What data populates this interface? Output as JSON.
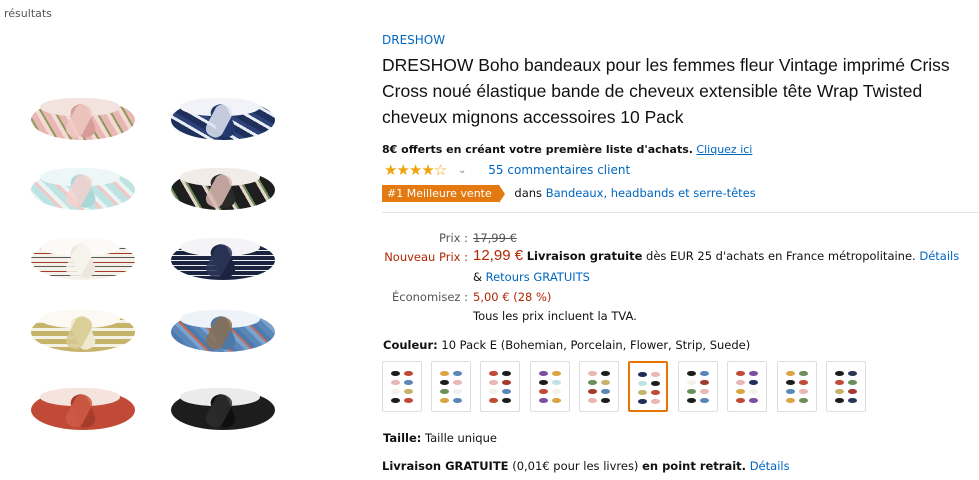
{
  "nav": {
    "back_link": "x résultats"
  },
  "product": {
    "brand": "DRESHOW",
    "title": "DRESHOW Boho bandeaux pour les femmes fleur Vintage imprimé Criss Cross noué élastique bande de cheveux extensible tête Wrap Twisted cheveux mignons accessoires 10 Pack",
    "gallery_alt": "10 Pack headbands"
  },
  "offer": {
    "bold_text": "8€ offerts en créant votre première liste d'achats.",
    "link": "Cliquez ici"
  },
  "rating": {
    "stars": "★★★★☆",
    "value": 4.3,
    "reviews": "55 commentaires client"
  },
  "bestseller": {
    "badge": "#1 Meilleure vente",
    "in_text": "dans",
    "category": "Bandeaux, headbands et serre-têtes"
  },
  "pricing": {
    "list_label": "Prix :",
    "list_price": "17,99 €",
    "new_label": "Nouveau Prix :",
    "new_price": "12,99 €",
    "free_delivery": "Livraison gratuite",
    "delivery_rest": "dès EUR 25 d'achats en France métropolitaine.",
    "details": "Détails",
    "amp": "&",
    "returns": "Retours GRATUITS",
    "save_label": "Économisez :",
    "save_value": "5,00 € (28 %)",
    "tax_note": "Tous les prix incluent la TVA."
  },
  "variation": {
    "color_label": "Couleur:",
    "color_value": "10 Pack E (Bohemian, Porcelain, Flower, Strip, Suede)",
    "selected_index": 5,
    "swatch_count": 10,
    "size_label": "Taille:",
    "size_value": "Taille unique"
  },
  "shipping": {
    "label": "Livraison GRATUITE",
    "paren": "(0,01€ pour les livres)",
    "where": "en point retrait.",
    "details": "Détails"
  },
  "colors": {
    "link": "#0066c0",
    "price": "#b12704",
    "badge": "#e47911",
    "star": "#f0a30a",
    "selected_border": "#e77600"
  }
}
